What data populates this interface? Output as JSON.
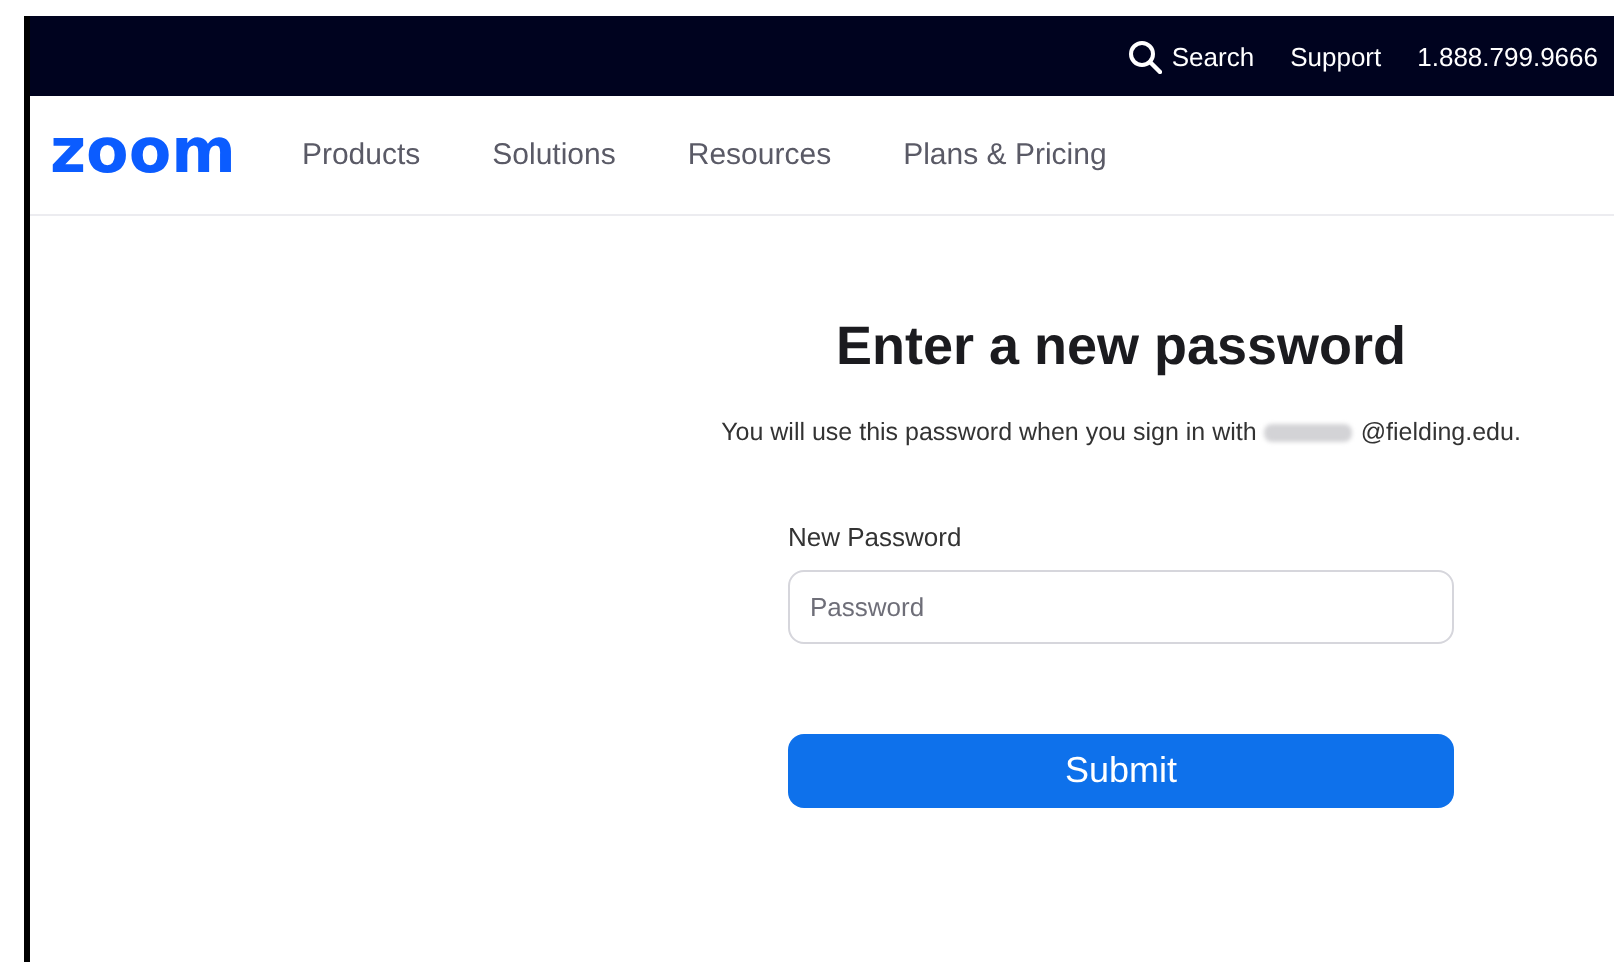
{
  "top_bar": {
    "search": "Search",
    "support": "Support",
    "phone": "1.888.799.9666"
  },
  "nav": {
    "logo": "zoom",
    "items": [
      "Products",
      "Solutions",
      "Resources",
      "Plans & Pricing"
    ]
  },
  "form": {
    "title": "Enter a new password",
    "note": "You will use this password when you sign in with",
    "email_visible": "@fielding.edu.",
    "field_label": "New Password",
    "field": {
      "placeholder": "Password"
    },
    "submit": "Submit"
  }
}
